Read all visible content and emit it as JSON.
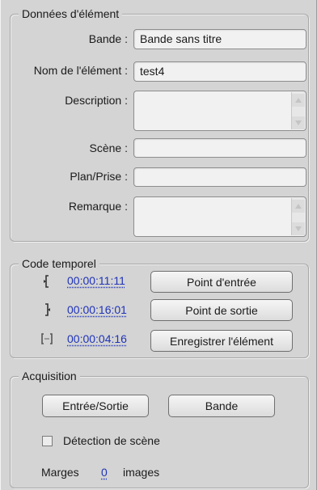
{
  "item_data": {
    "title": "Données d'élément",
    "tape_label": "Bande :",
    "tape_value": "Bande sans titre",
    "name_label": "Nom de l'élément :",
    "name_value": "test4",
    "description_label": "Description :",
    "description_value": "",
    "scene_label": "Scène :",
    "scene_value": "",
    "shot_label": "Plan/Prise :",
    "shot_value": "",
    "comment_label": "Remarque :",
    "comment_value": ""
  },
  "timecode": {
    "title": "Code temporel",
    "in_value": "00:00:11:11",
    "in_button": "Point d'entrée",
    "out_value": "00:00:16:01",
    "out_button": "Point de sortie",
    "duration_value": "00:00:04:16",
    "log_button": "Enregistrer l'élément"
  },
  "capture": {
    "title": "Acquisition",
    "in_out_button": "Entrée/Sortie",
    "tape_button": "Bande",
    "scene_detect_label": "Détection de scène",
    "scene_detect_checked": false,
    "handles_label": "Marges",
    "handles_value": "0",
    "handles_unit": "images"
  },
  "icons": {
    "scroll_up": "scroll-up-arrow-icon",
    "scroll_down": "scroll-down-arrow-icon",
    "in_point": "in-point-bracket-icon",
    "out_point": "out-point-bracket-icon",
    "duration": "duration-brackets-icon"
  }
}
